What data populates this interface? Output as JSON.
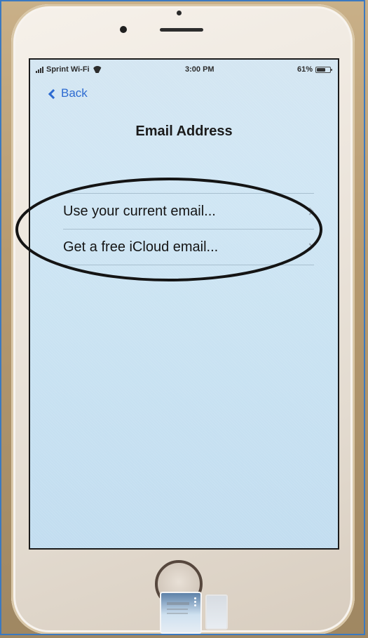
{
  "status_bar": {
    "carrier": "Sprint Wi-Fi",
    "time": "3:00 PM",
    "battery": "61%"
  },
  "navigation": {
    "back_label": "Back"
  },
  "page": {
    "title": "Email Address"
  },
  "options": [
    {
      "label": "Use your current email..."
    },
    {
      "label": "Get a free iCloud email..."
    }
  ],
  "icons": {
    "back": "chevron-left-icon",
    "row": "chevron-right-icon",
    "signal": "signal-icon",
    "wifi": "wifi-icon",
    "battery": "battery-icon"
  }
}
